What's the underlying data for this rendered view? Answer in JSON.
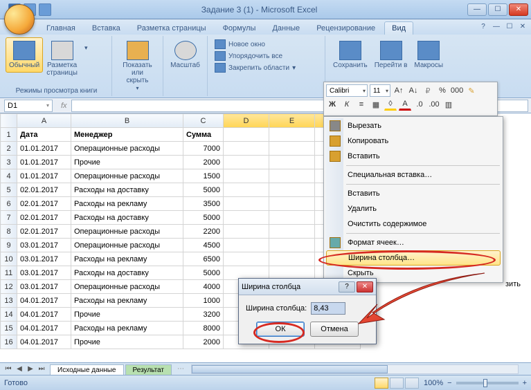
{
  "title": "Задание 3 (1) - Microsoft Excel",
  "tabs": [
    "Главная",
    "Вставка",
    "Разметка страницы",
    "Формулы",
    "Данные",
    "Рецензирование",
    "Вид"
  ],
  "ribbon": {
    "g1": {
      "b1": "Обычный",
      "b2": "Разметка\nстраницы",
      "label": "Режимы просмотра книги"
    },
    "g2": {
      "b1": "Показать\nили скрыть",
      "label": ""
    },
    "g3": {
      "b1": "Масштаб",
      "label": ""
    },
    "g4": {
      "i1": "Новое окно",
      "i2": "Упорядочить все",
      "i3": "Закрепить области"
    },
    "g5": {
      "b1": "Сохранить",
      "b2": "Перейти в",
      "b3": "Макросы"
    }
  },
  "namebox": "D1",
  "minibar": {
    "font": "Calibri",
    "size": "11"
  },
  "headers": [
    "A",
    "B",
    "C",
    "D",
    "E",
    "F"
  ],
  "h_row": [
    "Дата",
    "Менеджер",
    "Сумма"
  ],
  "rows": [
    [
      "01.01.2017",
      "Операционные расходы",
      "7000"
    ],
    [
      "01.01.2017",
      "Прочие",
      "2000"
    ],
    [
      "01.01.2017",
      "Операционные расходы",
      "1500"
    ],
    [
      "02.01.2017",
      "Расходы на доставку",
      "5000"
    ],
    [
      "02.01.2017",
      "Расходы на рекламу",
      "3500"
    ],
    [
      "02.01.2017",
      "Расходы на доставку",
      "5000"
    ],
    [
      "02.01.2017",
      "Операционные расходы",
      "2200"
    ],
    [
      "03.01.2017",
      "Операционные расходы",
      "4500"
    ],
    [
      "03.01.2017",
      "Расходы на рекламу",
      "6500"
    ],
    [
      "03.01.2017",
      "Расходы на доставку",
      "5000"
    ],
    [
      "03.01.2017",
      "Операционные расходы",
      "4000"
    ],
    [
      "04.01.2017",
      "Расходы на рекламу",
      "1000"
    ],
    [
      "04.01.2017",
      "Прочие",
      "3200"
    ],
    [
      "04.01.2017",
      "Расходы на рекламу",
      "8000"
    ],
    [
      "04.01.2017",
      "Прочие",
      "2000"
    ]
  ],
  "sheets": {
    "s1": "Исходные данные",
    "s2": "Результат"
  },
  "status": {
    "ready": "Готово",
    "zoom": "100%"
  },
  "ctx": {
    "cut": "Вырезать",
    "copy": "Копировать",
    "paste": "Вставить",
    "pastesp": "Специальная вставка…",
    "insert": "Вставить",
    "delete": "Удалить",
    "clear": "Очистить содержимое",
    "format": "Формат ячеек…",
    "colwidth": "Ширина столбца…",
    "hide": "Скрыть",
    "unhide": "зить"
  },
  "dlg": {
    "title": "Ширина столбца",
    "label": "Ширина столбца:",
    "value": "8,43",
    "ok": "ОК",
    "cancel": "Отмена"
  }
}
